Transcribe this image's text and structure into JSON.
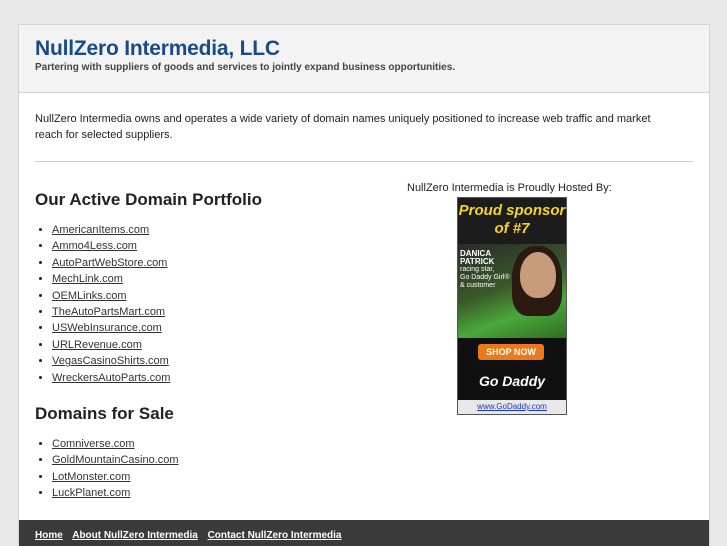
{
  "header": {
    "title": "NullZero Intermedia, LLC",
    "tagline": "Partering with suppliers of goods and services to jointly expand business opportunities."
  },
  "intro": {
    "text": "NullZero Intermedia owns and operates a wide variety of domain names uniquely positioned to increase web traffic and market reach for selected suppliers."
  },
  "portfolio": {
    "heading": "Our Active Domain Portfolio",
    "items": [
      "AmericanItems.com",
      "Ammo4Less.com",
      "AutoPartWebStore.com",
      "MechLink.com",
      "OEMLinks.com",
      "TheAutoPartsMart.com",
      "USWebInsurance.com",
      "URLRevenue.com",
      "VegasCasinoShirts.com",
      "WreckersAutoParts.com"
    ]
  },
  "for_sale": {
    "heading": "Domains for Sale",
    "items": [
      "Comniverse.com",
      "GoldMountainCasino.com",
      "LotMonster.com",
      "LuckPlanet.com"
    ]
  },
  "hosting": {
    "label": "NullZero Intermedia is Proudly Hosted By:",
    "ad": {
      "headline_1": "Proud sponsor",
      "headline_2": "of #7",
      "name": "DANICA PATRICK",
      "caption_1": "racing star,",
      "caption_2": "Go Daddy Girl®",
      "caption_3": "& customer",
      "shop_button": "SHOP NOW",
      "logo": "Go Daddy",
      "url": "www.GoDaddy.com",
      "colors": {
        "headline": "#f7d41e",
        "shop_button": "#e87a1a",
        "url": "#1a33cc"
      }
    }
  },
  "footer": {
    "links": [
      "Home",
      "About NullZero Intermedia",
      "Contact NullZero Intermedia"
    ]
  },
  "colors": {
    "title": "#1a4a8a",
    "footer_bg": "#3a3a3a",
    "page_bg": "#e8e8e8"
  }
}
